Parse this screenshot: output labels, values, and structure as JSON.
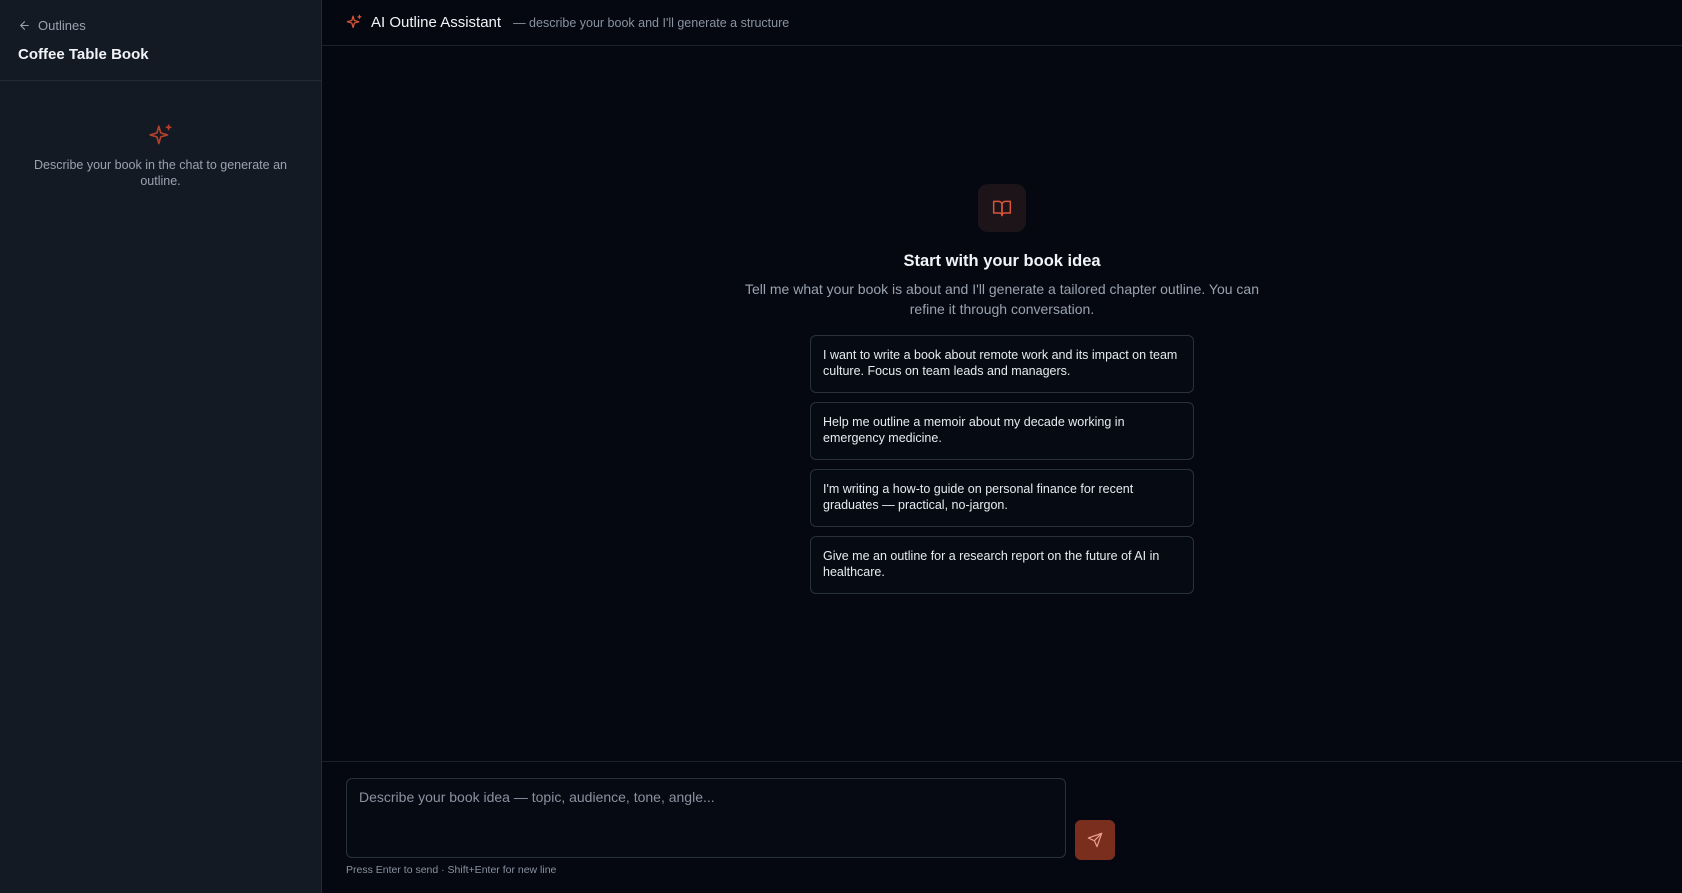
{
  "sidebar": {
    "back_label": "Outlines",
    "outline_title": "Coffee Table Book",
    "empty_text": "Describe your book in the chat to generate an outline."
  },
  "topbar": {
    "title": "AI Outline Assistant",
    "subtitle": "— describe your book and I'll generate a structure"
  },
  "hero": {
    "title": "Start with your book idea",
    "subtitle": "Tell me what your book is about and I'll generate a tailored chapter outline. You can refine it through conversation."
  },
  "suggestions": [
    "I want to write a book about remote work and its impact on team culture. Focus on team leads and managers.",
    "Help me outline a memoir about my decade working in emergency medicine.",
    "I'm writing a how-to guide on personal finance for recent graduates — practical, no-jargon.",
    "Give me an outline for a research report on the future of AI in healthcare."
  ],
  "composer": {
    "placeholder": "Describe your book idea — topic, audience, tone, angle...",
    "value": "",
    "hint": "Press Enter to send · Shift+Enter for new line"
  },
  "icons": {
    "back": "arrow-left-icon",
    "sparkle": "sparkles-icon",
    "book": "book-open-icon",
    "send": "send-icon"
  },
  "colors": {
    "accent": "#d9553a",
    "send_button": "#7a2f1e",
    "sidebar_bg": "#141a24",
    "main_bg": "#050810"
  }
}
